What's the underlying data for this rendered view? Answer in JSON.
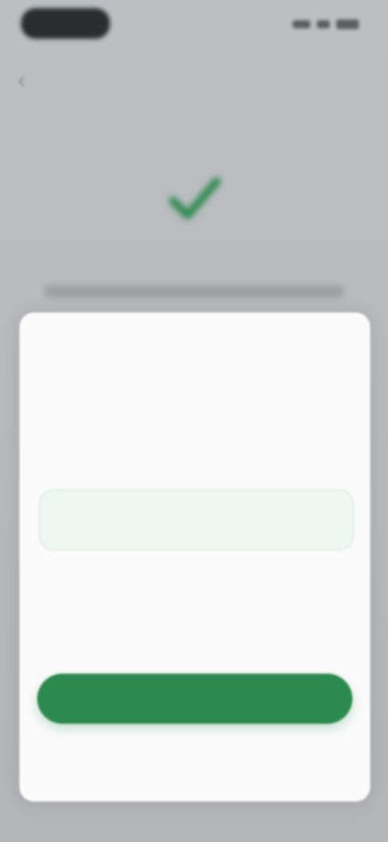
{
  "status_bar": {
    "icons": [
      "signal-icon",
      "wifi-icon",
      "battery-icon"
    ]
  },
  "nav": {
    "back_icon": "back-arrow-icon",
    "back_glyph": "‹"
  },
  "hero": {
    "icon": "checkmark-icon",
    "accent_color": "#2d8a4e"
  },
  "sheet": {
    "title": "",
    "picker": {
      "selected_label": "",
      "items": [
        "",
        "",
        "",
        ""
      ]
    },
    "confirm_label": "",
    "cancel_label": ""
  },
  "colors": {
    "accent": "#2d8a4e",
    "selected_bg": "#eef8f1",
    "backdrop": "#b9bcbf"
  }
}
